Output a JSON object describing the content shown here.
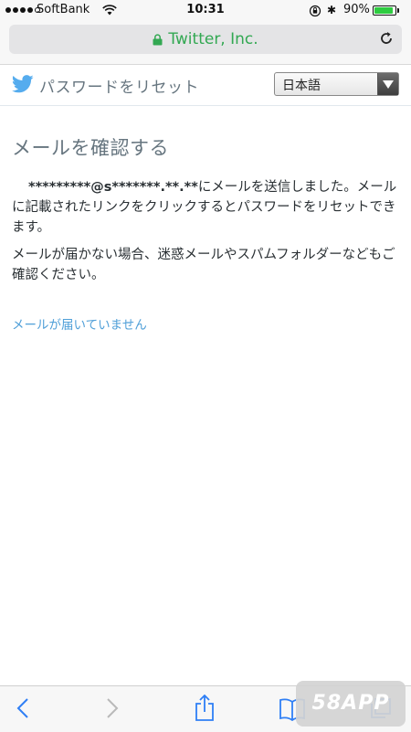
{
  "status_bar": {
    "carrier": "SoftBank",
    "time": "10:31",
    "battery_percent": "90%",
    "battery_level": 0.9
  },
  "browser": {
    "url_title": "Twitter, Inc."
  },
  "header": {
    "title": "パスワードをリセット",
    "language": "日本語"
  },
  "main": {
    "heading": "メールを確認する",
    "masked_email": "*********@s*******.**.**",
    "sent_text": "にメールを送信しました。メールに記載されたリンクをクリックするとパスワードをリセットできます。",
    "not_received_text": "メールが届かない場合、迷惑メールやスパムフォルダーなどもご確認ください。",
    "no_email_link": "メールが届いていません"
  },
  "watermark": "58APP",
  "colors": {
    "twitter_blue": "#55acee",
    "link": "#4f9fd8",
    "secure_url": "#32a852",
    "heading": "#66757f"
  }
}
